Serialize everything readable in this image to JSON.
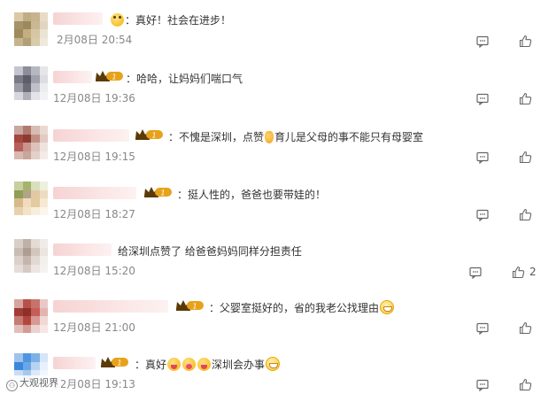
{
  "comments": [
    {
      "content_parts": [
        {
          "t": "text",
          "v": "："
        },
        {
          "t": "text",
          "v": "真好！社会在进步！"
        }
      ],
      "prefix_emoji": "cheer",
      "time": "2月08日 20:54",
      "likes": "",
      "avatar_colors": [
        "#d9c9a6",
        "#bfae84",
        "#c6b48e",
        "#e8dcc6",
        "#a7926a",
        "#9c8a5e",
        "#cbb892",
        "#e0d5bf",
        "#a08a5c",
        "#c2ae80",
        "#d6c7a2",
        "#ebe4d4",
        "#c5b58e",
        "#b39f75",
        "#d7cba9",
        "#efe9dd"
      ]
    },
    {
      "content_parts": [
        {
          "t": "text",
          "v": "：哈哈，让妈妈们喘口气"
        }
      ],
      "time": "12月08日 19:36",
      "likes": "",
      "avatar_colors": [
        "#c5c5cf",
        "#8d8d99",
        "#b7b7c2",
        "#e5e5ea",
        "#7a7a86",
        "#5d5d6a",
        "#a1a1ae",
        "#dcdce2",
        "#9c9ca8",
        "#6b6b78",
        "#c0c0ca",
        "#ececf0",
        "#d7d7de",
        "#b0b0bb",
        "#e3e3e8",
        "#f2f2f5"
      ]
    },
    {
      "content_parts": [
        {
          "t": "text",
          "v": "：不愧是深圳，点赞"
        },
        {
          "t": "emo",
          "v": "thumb"
        },
        {
          "t": "text",
          "v": "育儿是父母的事不能只有母婴室"
        }
      ],
      "time": "12月08日 19:15",
      "likes": "",
      "avatar_colors": [
        "#c7a79f",
        "#b07b6f",
        "#d6bcb2",
        "#ead9d3",
        "#a3463c",
        "#8c3a32",
        "#c28f84",
        "#e1cbc4",
        "#b5605a",
        "#c9948b",
        "#dcc2ba",
        "#efe3df",
        "#d7b9b0",
        "#c9a59b",
        "#e3d0ca",
        "#f3ebe8"
      ]
    },
    {
      "content_parts": [
        {
          "t": "text",
          "v": "：挺人性的，爸爸也要带娃的！"
        }
      ],
      "time": "12月08日 18:27",
      "likes": "",
      "avatar_colors": [
        "#c8cf9f",
        "#a5b36c",
        "#d9dfbc",
        "#edf0dc",
        "#8f9f55",
        "#b2a48a",
        "#e1c9a4",
        "#ecdcc1",
        "#d8b98a",
        "#f0dcbc",
        "#e4caa0",
        "#f5e9d4",
        "#e8d2ad",
        "#f2e2c7",
        "#f7eedc",
        "#fbf5ea"
      ]
    },
    {
      "content_parts": [
        {
          "t": "text",
          "v": "给深圳点赞了 给爸爸妈妈同样分担责任"
        }
      ],
      "time": "12月08日 15:20",
      "likes": "2",
      "avatar_colors": [
        "#d8cfc8",
        "#bfb1a8",
        "#e4dbd5",
        "#f0ebe8",
        "#c9bcb3",
        "#ad9e94",
        "#d3c6be",
        "#ebe4df",
        "#dcd1ca",
        "#c4b6ad",
        "#e2d8d2",
        "#f3efec",
        "#e6ddd8",
        "#d5c9c1",
        "#ece5e1",
        "#f6f2f0"
      ]
    },
    {
      "content_parts": [
        {
          "t": "text",
          "v": "：父婴室挺好的，省的我老公找理由"
        },
        {
          "t": "emo",
          "v": "grin"
        }
      ],
      "time": "12月08日 21:00",
      "likes": "",
      "avatar_colors": [
        "#d7a5a0",
        "#b8514a",
        "#c7736c",
        "#e9c9c5",
        "#a13b35",
        "#8f2f2a",
        "#c55e57",
        "#e2b4af",
        "#c47c75",
        "#b2463f",
        "#d69993",
        "#f0d8d5",
        "#e3bfbb",
        "#d49a94",
        "#ecd0cd",
        "#f6e6e4"
      ]
    },
    {
      "content_parts": [
        {
          "t": "text",
          "v": "：真好"
        },
        {
          "t": "emo",
          "v": "tongue"
        },
        {
          "t": "emo",
          "v": "kiss"
        },
        {
          "t": "emo",
          "v": "tongue"
        },
        {
          "t": "text",
          "v": "深圳会办事"
        },
        {
          "t": "emo",
          "v": "grin"
        }
      ],
      "time": "12月08日 19:13",
      "likes": "",
      "avatar_colors": [
        "#9fc3ec",
        "#4f95e0",
        "#7cb1e8",
        "#d5e6f7",
        "#3c87dc",
        "#6aa7e6",
        "#b6d3f2",
        "#e8f1fb",
        "#c9ddf5",
        "#a5c8ef",
        "#dde9f8",
        "#f2f7fd",
        "#e4eefa",
        "#d2e3f6",
        "#eef4fc",
        "#f8fbfe"
      ]
    }
  ],
  "watermark": "大观视界",
  "colors": {
    "crown_gold": "#e7a21b",
    "crown_dark": "#5b3a08",
    "username_pink": "#f6d3d3",
    "time_gray": "#888888"
  }
}
